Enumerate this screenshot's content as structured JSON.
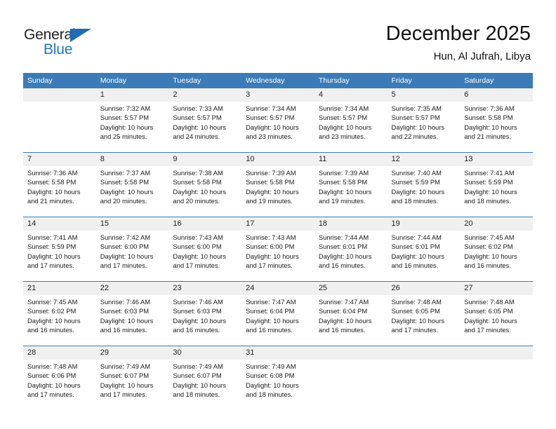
{
  "brand": {
    "name_part1": "General",
    "name_part2": "Blue",
    "accent_color": "#1f7ac4",
    "triangle_color": "#1f6db5"
  },
  "header": {
    "title": "December 2025",
    "subtitle": "Hun, Al Jufrah, Libya"
  },
  "calendar": {
    "header_bg": "#3b7cb8",
    "daynum_bg": "#f0f0f0",
    "weekday_headers": [
      "Sunday",
      "Monday",
      "Tuesday",
      "Wednesday",
      "Thursday",
      "Friday",
      "Saturday"
    ],
    "weeks": [
      [
        {
          "day": "",
          "sunrise": "",
          "sunset": "",
          "daylight_1": "",
          "daylight_2": ""
        },
        {
          "day": "1",
          "sunrise": "Sunrise: 7:32 AM",
          "sunset": "Sunset: 5:57 PM",
          "daylight_1": "Daylight: 10 hours",
          "daylight_2": "and 25 minutes."
        },
        {
          "day": "2",
          "sunrise": "Sunrise: 7:33 AM",
          "sunset": "Sunset: 5:57 PM",
          "daylight_1": "Daylight: 10 hours",
          "daylight_2": "and 24 minutes."
        },
        {
          "day": "3",
          "sunrise": "Sunrise: 7:34 AM",
          "sunset": "Sunset: 5:57 PM",
          "daylight_1": "Daylight: 10 hours",
          "daylight_2": "and 23 minutes."
        },
        {
          "day": "4",
          "sunrise": "Sunrise: 7:34 AM",
          "sunset": "Sunset: 5:57 PM",
          "daylight_1": "Daylight: 10 hours",
          "daylight_2": "and 23 minutes."
        },
        {
          "day": "5",
          "sunrise": "Sunrise: 7:35 AM",
          "sunset": "Sunset: 5:57 PM",
          "daylight_1": "Daylight: 10 hours",
          "daylight_2": "and 22 minutes."
        },
        {
          "day": "6",
          "sunrise": "Sunrise: 7:36 AM",
          "sunset": "Sunset: 5:58 PM",
          "daylight_1": "Daylight: 10 hours",
          "daylight_2": "and 21 minutes."
        }
      ],
      [
        {
          "day": "7",
          "sunrise": "Sunrise: 7:36 AM",
          "sunset": "Sunset: 5:58 PM",
          "daylight_1": "Daylight: 10 hours",
          "daylight_2": "and 21 minutes."
        },
        {
          "day": "8",
          "sunrise": "Sunrise: 7:37 AM",
          "sunset": "Sunset: 5:58 PM",
          "daylight_1": "Daylight: 10 hours",
          "daylight_2": "and 20 minutes."
        },
        {
          "day": "9",
          "sunrise": "Sunrise: 7:38 AM",
          "sunset": "Sunset: 5:58 PM",
          "daylight_1": "Daylight: 10 hours",
          "daylight_2": "and 20 minutes."
        },
        {
          "day": "10",
          "sunrise": "Sunrise: 7:39 AM",
          "sunset": "Sunset: 5:58 PM",
          "daylight_1": "Daylight: 10 hours",
          "daylight_2": "and 19 minutes."
        },
        {
          "day": "11",
          "sunrise": "Sunrise: 7:39 AM",
          "sunset": "Sunset: 5:58 PM",
          "daylight_1": "Daylight: 10 hours",
          "daylight_2": "and 19 minutes."
        },
        {
          "day": "12",
          "sunrise": "Sunrise: 7:40 AM",
          "sunset": "Sunset: 5:59 PM",
          "daylight_1": "Daylight: 10 hours",
          "daylight_2": "and 18 minutes."
        },
        {
          "day": "13",
          "sunrise": "Sunrise: 7:41 AM",
          "sunset": "Sunset: 5:59 PM",
          "daylight_1": "Daylight: 10 hours",
          "daylight_2": "and 18 minutes."
        }
      ],
      [
        {
          "day": "14",
          "sunrise": "Sunrise: 7:41 AM",
          "sunset": "Sunset: 5:59 PM",
          "daylight_1": "Daylight: 10 hours",
          "daylight_2": "and 17 minutes."
        },
        {
          "day": "15",
          "sunrise": "Sunrise: 7:42 AM",
          "sunset": "Sunset: 6:00 PM",
          "daylight_1": "Daylight: 10 hours",
          "daylight_2": "and 17 minutes."
        },
        {
          "day": "16",
          "sunrise": "Sunrise: 7:43 AM",
          "sunset": "Sunset: 6:00 PM",
          "daylight_1": "Daylight: 10 hours",
          "daylight_2": "and 17 minutes."
        },
        {
          "day": "17",
          "sunrise": "Sunrise: 7:43 AM",
          "sunset": "Sunset: 6:00 PM",
          "daylight_1": "Daylight: 10 hours",
          "daylight_2": "and 17 minutes."
        },
        {
          "day": "18",
          "sunrise": "Sunrise: 7:44 AM",
          "sunset": "Sunset: 6:01 PM",
          "daylight_1": "Daylight: 10 hours",
          "daylight_2": "and 16 minutes."
        },
        {
          "day": "19",
          "sunrise": "Sunrise: 7:44 AM",
          "sunset": "Sunset: 6:01 PM",
          "daylight_1": "Daylight: 10 hours",
          "daylight_2": "and 16 minutes."
        },
        {
          "day": "20",
          "sunrise": "Sunrise: 7:45 AM",
          "sunset": "Sunset: 6:02 PM",
          "daylight_1": "Daylight: 10 hours",
          "daylight_2": "and 16 minutes."
        }
      ],
      [
        {
          "day": "21",
          "sunrise": "Sunrise: 7:45 AM",
          "sunset": "Sunset: 6:02 PM",
          "daylight_1": "Daylight: 10 hours",
          "daylight_2": "and 16 minutes."
        },
        {
          "day": "22",
          "sunrise": "Sunrise: 7:46 AM",
          "sunset": "Sunset: 6:03 PM",
          "daylight_1": "Daylight: 10 hours",
          "daylight_2": "and 16 minutes."
        },
        {
          "day": "23",
          "sunrise": "Sunrise: 7:46 AM",
          "sunset": "Sunset: 6:03 PM",
          "daylight_1": "Daylight: 10 hours",
          "daylight_2": "and 16 minutes."
        },
        {
          "day": "24",
          "sunrise": "Sunrise: 7:47 AM",
          "sunset": "Sunset: 6:04 PM",
          "daylight_1": "Daylight: 10 hours",
          "daylight_2": "and 16 minutes."
        },
        {
          "day": "25",
          "sunrise": "Sunrise: 7:47 AM",
          "sunset": "Sunset: 6:04 PM",
          "daylight_1": "Daylight: 10 hours",
          "daylight_2": "and 16 minutes."
        },
        {
          "day": "26",
          "sunrise": "Sunrise: 7:48 AM",
          "sunset": "Sunset: 6:05 PM",
          "daylight_1": "Daylight: 10 hours",
          "daylight_2": "and 17 minutes."
        },
        {
          "day": "27",
          "sunrise": "Sunrise: 7:48 AM",
          "sunset": "Sunset: 6:05 PM",
          "daylight_1": "Daylight: 10 hours",
          "daylight_2": "and 17 minutes."
        }
      ],
      [
        {
          "day": "28",
          "sunrise": "Sunrise: 7:48 AM",
          "sunset": "Sunset: 6:06 PM",
          "daylight_1": "Daylight: 10 hours",
          "daylight_2": "and 17 minutes."
        },
        {
          "day": "29",
          "sunrise": "Sunrise: 7:49 AM",
          "sunset": "Sunset: 6:07 PM",
          "daylight_1": "Daylight: 10 hours",
          "daylight_2": "and 17 minutes."
        },
        {
          "day": "30",
          "sunrise": "Sunrise: 7:49 AM",
          "sunset": "Sunset: 6:07 PM",
          "daylight_1": "Daylight: 10 hours",
          "daylight_2": "and 18 minutes."
        },
        {
          "day": "31",
          "sunrise": "Sunrise: 7:49 AM",
          "sunset": "Sunset: 6:08 PM",
          "daylight_1": "Daylight: 10 hours",
          "daylight_2": "and 18 minutes."
        },
        {
          "day": "",
          "sunrise": "",
          "sunset": "",
          "daylight_1": "",
          "daylight_2": ""
        },
        {
          "day": "",
          "sunrise": "",
          "sunset": "",
          "daylight_1": "",
          "daylight_2": ""
        },
        {
          "day": "",
          "sunrise": "",
          "sunset": "",
          "daylight_1": "",
          "daylight_2": ""
        }
      ]
    ]
  }
}
